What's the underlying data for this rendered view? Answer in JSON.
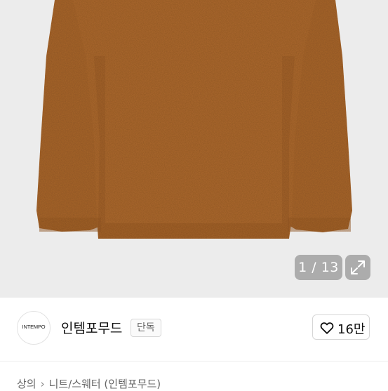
{
  "product_image": {
    "description_icon": "sweater-photo",
    "background_color": "#ececec",
    "sweater_color": "#a8652a",
    "counter_text": "1 / 13",
    "expand_icon": "expand-arrows-icon"
  },
  "seller": {
    "avatar_text": "INTEMPO",
    "name": "인템포무드",
    "badge": "단독",
    "like_icon": "heart-outline-icon",
    "like_count": "16만"
  },
  "breadcrumb": {
    "items": [
      "상의",
      "니트/스웨터 (인템포무드)"
    ],
    "separator_icon": "chevron-right-icon",
    "separator": "›"
  }
}
